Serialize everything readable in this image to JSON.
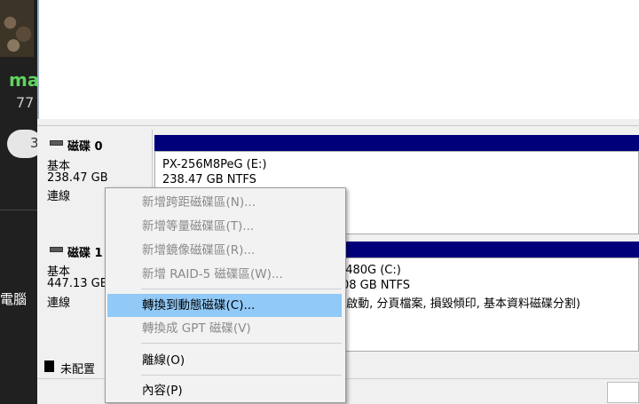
{
  "background_app": {
    "user_name_partial": "ma",
    "user_number_partial": "77",
    "pill_text_partial": "3",
    "pc_label_partial": "電腦"
  },
  "disks": [
    {
      "title": "磁碟 0",
      "type": "基本",
      "size": "238.47 GB",
      "status": "連線",
      "partition": {
        "name": "PX-256M8PeG  (E:)",
        "detail": "238.47 GB NTFS",
        "status_text": ""
      }
    },
    {
      "title": "磁碟 1",
      "type": "基本",
      "size": "447.13 GB",
      "status": "連線",
      "partition": {
        "name_visible": ") 480G  (C:)",
        "detail_visible": "08 GB NTFS",
        "status_visible": "(啟動, 分頁檔案, 損毀傾印, 基本資料磁碟分割)"
      }
    }
  ],
  "unallocated_label": "未配置",
  "context_menu": {
    "items": [
      {
        "label": "新增跨距磁碟區(N)...",
        "enabled": false
      },
      {
        "label": "新增等量磁碟區(T)...",
        "enabled": false
      },
      {
        "label": "新增鏡像磁碟區(R)...",
        "enabled": false
      },
      {
        "label": "新增 RAID-5 磁碟區(W)...",
        "enabled": false
      },
      {
        "label": "轉換到動態磁碟(C)...",
        "enabled": true,
        "highlighted": true
      },
      {
        "label": "轉換成 GPT 磁碟(V)",
        "enabled": false
      },
      {
        "label": "離線(O)",
        "enabled": true
      },
      {
        "label": "內容(P)",
        "enabled": true
      }
    ]
  },
  "colors": {
    "partition_bar": "#00007b",
    "menu_highlight": "#91c9f7",
    "user_name": "#5fd35f"
  }
}
